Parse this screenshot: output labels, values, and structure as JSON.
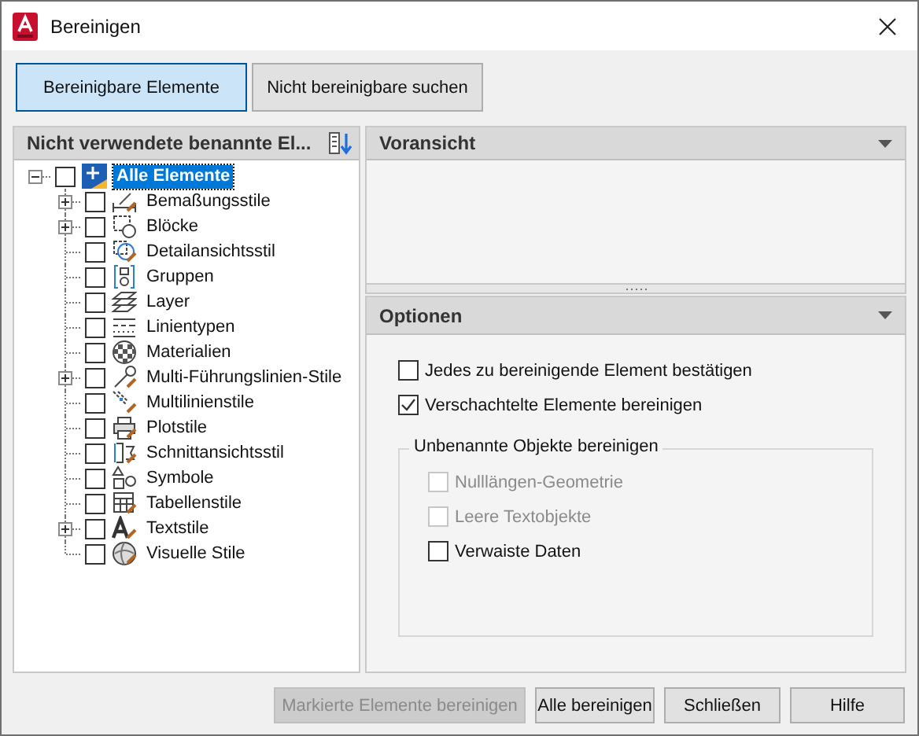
{
  "window": {
    "title": "Bereinigen"
  },
  "mode_buttons": [
    {
      "label": "Bereinigbare Elemente",
      "selected": true
    },
    {
      "label": "Nicht bereinigbare suchen",
      "selected": false
    }
  ],
  "tree_panel": {
    "title": "Nicht verwendete benannte El...",
    "root": {
      "label": "Alle Elemente",
      "checked": false,
      "expanded": true,
      "selected": true,
      "children": [
        {
          "label": "Bemaßungsstile",
          "kind": "dimension",
          "checked": false,
          "expandable": true
        },
        {
          "label": "Blöcke",
          "kind": "block",
          "checked": false,
          "expandable": true
        },
        {
          "label": "Detailansichtsstil",
          "kind": "detail",
          "checked": false,
          "expandable": false
        },
        {
          "label": "Gruppen",
          "kind": "group",
          "checked": false,
          "expandable": false
        },
        {
          "label": "Layer",
          "kind": "layer",
          "checked": false,
          "expandable": false
        },
        {
          "label": "Linientypen",
          "kind": "linetype",
          "checked": false,
          "expandable": false
        },
        {
          "label": "Materialien",
          "kind": "material",
          "checked": false,
          "expandable": false
        },
        {
          "label": "Multi-Führungslinien-Stile",
          "kind": "mleader",
          "checked": false,
          "expandable": true
        },
        {
          "label": "Multilinienstile",
          "kind": "mline",
          "checked": false,
          "expandable": false
        },
        {
          "label": "Plotstile",
          "kind": "plot",
          "checked": false,
          "expandable": false
        },
        {
          "label": "Schnittansichtsstil",
          "kind": "section",
          "checked": false,
          "expandable": false
        },
        {
          "label": "Symbole",
          "kind": "symbol",
          "checked": false,
          "expandable": false
        },
        {
          "label": "Tabellenstile",
          "kind": "table",
          "checked": false,
          "expandable": false
        },
        {
          "label": "Textstile",
          "kind": "text",
          "checked": false,
          "expandable": true
        },
        {
          "label": "Visuelle Stile",
          "kind": "visual",
          "checked": false,
          "expandable": false
        }
      ]
    }
  },
  "preview_panel": {
    "title": "Voransicht"
  },
  "options_panel": {
    "title": "Optionen",
    "options": [
      {
        "label": "Jedes zu bereinigende Element bestätigen",
        "checked": false,
        "disabled": false
      },
      {
        "label": "Verschachtelte Elemente bereinigen",
        "checked": true,
        "disabled": false
      }
    ],
    "group": {
      "title": "Unbenannte Objekte bereinigen",
      "options": [
        {
          "label": "Nulllängen-Geometrie",
          "checked": false,
          "disabled": true
        },
        {
          "label": "Leere Textobjekte",
          "checked": false,
          "disabled": true
        },
        {
          "label": "Verwaiste Daten",
          "checked": false,
          "disabled": false
        }
      ]
    }
  },
  "buttons": [
    {
      "label": "Markierte Elemente bereinigen",
      "disabled": true
    },
    {
      "label": "Alle bereinigen",
      "disabled": false
    },
    {
      "label": "Schließen",
      "disabled": false
    },
    {
      "label": "Hilfe",
      "disabled": false
    }
  ]
}
